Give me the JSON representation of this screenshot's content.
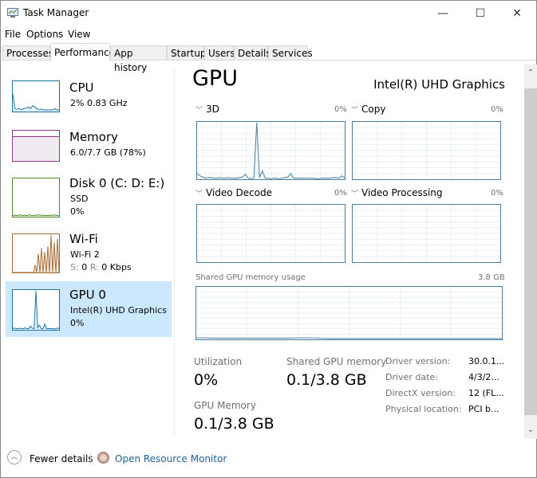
{
  "window": {
    "title": "Task Manager",
    "controls": {
      "minimize": "—",
      "maximize": "☐",
      "close": "✕"
    }
  },
  "menu": [
    "File",
    "Options",
    "View"
  ],
  "tabs": [
    {
      "label": "Processes",
      "active": false
    },
    {
      "label": "Performance",
      "active": true
    },
    {
      "label": "App history",
      "active": false
    },
    {
      "label": "Startup",
      "active": false
    },
    {
      "label": "Users",
      "active": false
    },
    {
      "label": "Details",
      "active": false
    },
    {
      "label": "Services",
      "active": false
    }
  ],
  "sidebar": {
    "items": [
      {
        "title": "CPU",
        "line1": "2%  0.83 GHz",
        "line2": "",
        "color": "#1a73a8",
        "selected": false
      },
      {
        "title": "Memory",
        "line1": "6.0/7.7 GB (78%)",
        "line2": "",
        "color": "#8b3a8b",
        "selected": false,
        "usage": 0.78
      },
      {
        "title": "Disk 0 (C: D: E:)",
        "line1": "SSD",
        "line2": "0%",
        "color": "#4d8c1e",
        "selected": false
      },
      {
        "title": "Wi-Fi",
        "line1": "Wi-Fi 2",
        "line2_s": "S:",
        "line2_sv": "0",
        "line2_r": "R:",
        "line2_rv": "0 Kbps",
        "color": "#a76a30",
        "selected": false
      },
      {
        "title": "GPU 0",
        "line1": "Intel(R) UHD Graphics",
        "line2": "0%",
        "color": "#1a73a8",
        "selected": true
      }
    ]
  },
  "main": {
    "title": "GPU",
    "device_name": "Intel(R) UHD Graphics",
    "engines": [
      {
        "label": "3D",
        "percent": "0%"
      },
      {
        "label": "Copy",
        "percent": "0%"
      },
      {
        "label": "Video Decode",
        "percent": "0%"
      },
      {
        "label": "Video Processing",
        "percent": "0%"
      }
    ],
    "shared_memory_graph": {
      "label": "Shared GPU memory usage",
      "max": "3.8 GB"
    },
    "stats": {
      "utilization_label": "Utilization",
      "utilization_value": "0%",
      "shared_label": "Shared GPU memory",
      "shared_value": "0.1/3.8 GB",
      "gpu_memory_label": "GPU Memory",
      "gpu_memory_value": "0.1/3.8 GB"
    },
    "details": [
      {
        "label": "Driver version:",
        "value": "30.0.1..."
      },
      {
        "label": "Driver date:",
        "value": "4/3/2..."
      },
      {
        "label": "DirectX version:",
        "value": "12 (FL..."
      },
      {
        "label": "Physical location:",
        "value": "PCI b..."
      }
    ]
  },
  "footer": {
    "fewer_details": "Fewer details",
    "open_monitor": "Open Resource Monitor"
  },
  "series": {
    "gpu3d": [
      0.1,
      0.06,
      0.04,
      0.02,
      0.03,
      0.03,
      0.02,
      0.02,
      0.03,
      0.02,
      0.02,
      0.03,
      0.02,
      0.02,
      0.02,
      0.03,
      0.04,
      0.09,
      0.02,
      0.01,
      0.02,
      1.0,
      0.03,
      0.15,
      0.02,
      0.02,
      0.01,
      0.02,
      0.02,
      0.01,
      0.02,
      0.03,
      0.04,
      0.1,
      0.02,
      0.02,
      0.02,
      0.02,
      0.02,
      0.02,
      0.02,
      0.02,
      0.01,
      0.01,
      0.02,
      0.02,
      0.02,
      0.02,
      0.03,
      0.03,
      0.02,
      0.06,
      0.03
    ],
    "shared_mem": [
      0.03,
      0.03,
      0.025,
      0.025,
      0.025,
      0.025,
      0.025,
      0.025,
      0.025,
      0.025,
      0.025,
      0.025,
      0.025,
      0.03,
      0.03,
      0.03,
      0.02,
      0.015,
      0.015,
      0.015,
      0.015,
      0.015,
      0.015,
      0.015,
      0.015,
      0.015,
      0.015,
      0.015,
      0.015,
      0.015,
      0.015,
      0.015,
      0.015,
      0.015,
      0.015,
      0.015,
      0.015,
      0.015,
      0.015,
      0.015
    ],
    "cpu_thumb": [
      0.6,
      0.1,
      0.08,
      0.1,
      0.06,
      0.1,
      0.12,
      0.15,
      0.1,
      0.2,
      0.15,
      0.1,
      0.06,
      0.08,
      0.05,
      0.06,
      0.05,
      0.06,
      0.05,
      0.1,
      0.06,
      0.05
    ],
    "disk_thumb": [
      0.03,
      0.04,
      0.03,
      0.05,
      0.03,
      0.04,
      0.03,
      0.05,
      0.03,
      0.04,
      0.04,
      0.05,
      0.03,
      0.04,
      0.03,
      0.04,
      0.03,
      0.05,
      0.03,
      0.04
    ],
    "wifi_thumb": [
      0,
      0,
      0,
      0,
      0,
      0,
      0,
      0,
      0,
      0,
      0,
      0,
      0,
      0,
      0.2,
      0,
      0.5,
      0,
      0.65,
      0,
      0.55,
      0,
      0.7,
      0,
      1.0,
      0,
      0.8,
      0,
      0.9,
      0
    ],
    "gpu_thumb": [
      0.04,
      0.04,
      0.03,
      0.03,
      0.04,
      0.03,
      0.03,
      0.05,
      0.03,
      0.03,
      0.1,
      0.04,
      0.03,
      1.0,
      0.05,
      0.12,
      0.03,
      0.03,
      0.15,
      0.03,
      0.03,
      0.03,
      0.03,
      0.02,
      0.03,
      0.04,
      0.04
    ]
  }
}
